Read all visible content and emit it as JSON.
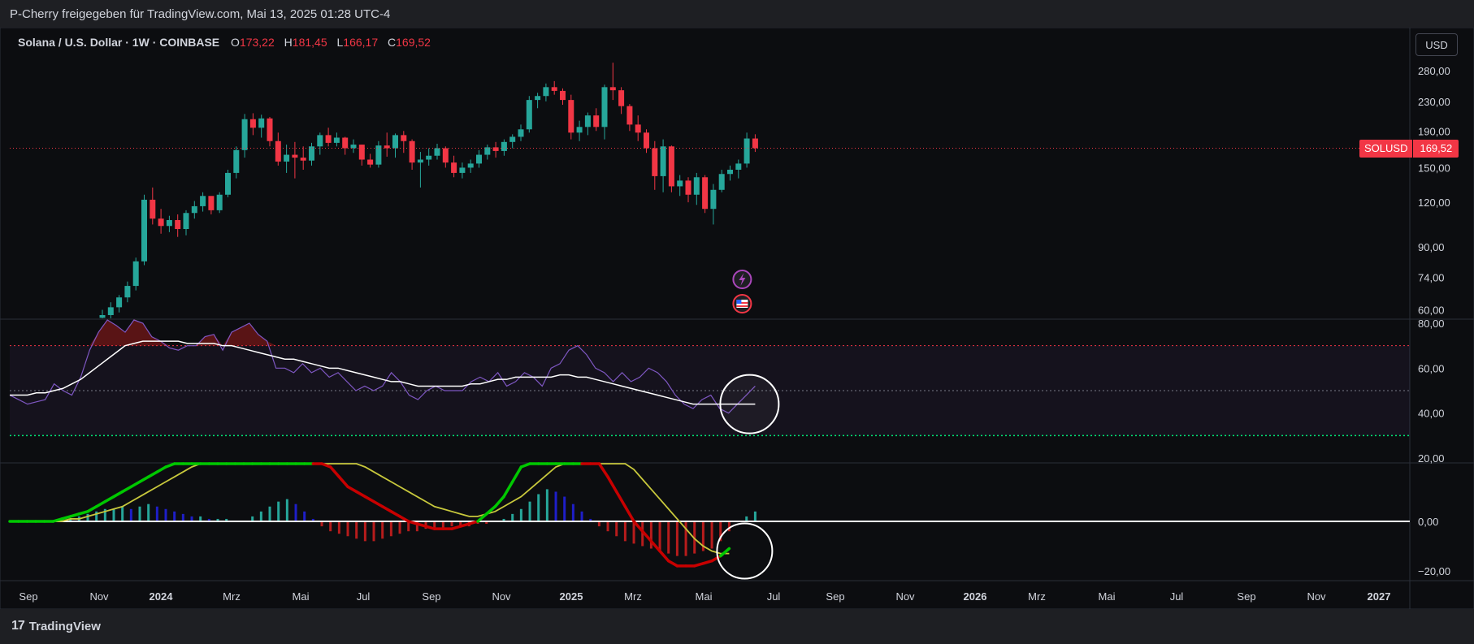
{
  "header": {
    "text": "P-Cherry freigegeben für TradingView.com, Mai 13, 2025 01:28 UTC-4"
  },
  "footer": {
    "brand": "TradingView",
    "logo_icon": "tradingview-logo-icon"
  },
  "legend": {
    "symbol": "Solana / U.S. Dollar · 1W · COINBASE",
    "open_label": "O",
    "open": "173,22",
    "high_label": "H",
    "high": "181,45",
    "low_label": "L",
    "low": "166,17",
    "close_label": "C",
    "close": "169,52"
  },
  "currency": "USD",
  "price_tag": {
    "symbol": "SOLUSD",
    "price": "169,52"
  },
  "colors": {
    "up": "#26a69a",
    "down": "#f23645",
    "rsi": "#7e57c2",
    "rsi_ma": "#ffffff",
    "macd_up": "#00c800",
    "macd_down": "#c80000",
    "signal": "#c8c83c",
    "hist_pos_strong": "#26a69a",
    "hist_pos_weak": "#1e1ec8",
    "hist_neg": "#b71c1c"
  },
  "chart_data": [
    {
      "type": "candlestick",
      "panel": "price",
      "title": "Solana / U.S. Dollar · 1W · COINBASE",
      "y_scale": "log",
      "ylim": [
        58,
        300
      ],
      "y_ticks": [
        "280,00",
        "230,00",
        "190,00",
        "150,00",
        "120,00",
        "90,00",
        "74,00",
        "60,00"
      ],
      "y_tick_values": [
        280,
        230,
        190,
        150,
        120,
        90,
        74,
        60
      ],
      "candles": [
        [
          57,
          60,
          55,
          58
        ],
        [
          58,
          63,
          56,
          61
        ],
        [
          61,
          66,
          59,
          65
        ],
        [
          65,
          72,
          63,
          70
        ],
        [
          70,
          84,
          68,
          82
        ],
        [
          82,
          126,
          80,
          122
        ],
        [
          122,
          132,
          104,
          108
        ],
        [
          108,
          115,
          98,
          103
        ],
        [
          103,
          110,
          99,
          107
        ],
        [
          107,
          111,
          96,
          101
        ],
        [
          101,
          114,
          97,
          112
        ],
        [
          112,
          121,
          108,
          117
        ],
        [
          117,
          128,
          113,
          125
        ],
        [
          125,
          122,
          111,
          114
        ],
        [
          114,
          128,
          112,
          126
        ],
        [
          126,
          148,
          124,
          145
        ],
        [
          145,
          172,
          140,
          168
        ],
        [
          168,
          212,
          160,
          205
        ],
        [
          205,
          213,
          185,
          194
        ],
        [
          194,
          211,
          182,
          206
        ],
        [
          206,
          208,
          172,
          178
        ],
        [
          178,
          188,
          152,
          156
        ],
        [
          156,
          174,
          145,
          163
        ],
        [
          163,
          177,
          140,
          160
        ],
        [
          160,
          172,
          148,
          157
        ],
        [
          157,
          176,
          152,
          172
        ],
        [
          172,
          188,
          163,
          185
        ],
        [
          185,
          194,
          172,
          176
        ],
        [
          176,
          188,
          172,
          182
        ],
        [
          182,
          183,
          163,
          170
        ],
        [
          170,
          180,
          165,
          174
        ],
        [
          174,
          174,
          152,
          158
        ],
        [
          158,
          164,
          150,
          153
        ],
        [
          153,
          178,
          150,
          173
        ],
        [
          173,
          188,
          161,
          170
        ],
        [
          170,
          187,
          160,
          185
        ],
        [
          185,
          190,
          165,
          178
        ],
        [
          178,
          180,
          148,
          155
        ],
        [
          155,
          166,
          132,
          158
        ],
        [
          158,
          170,
          152,
          162
        ],
        [
          162,
          175,
          158,
          170
        ],
        [
          170,
          172,
          150,
          155
        ],
        [
          155,
          162,
          141,
          145
        ],
        [
          145,
          155,
          140,
          150
        ],
        [
          150,
          158,
          145,
          154
        ],
        [
          154,
          168,
          150,
          163
        ],
        [
          163,
          174,
          158,
          171
        ],
        [
          171,
          177,
          160,
          167
        ],
        [
          167,
          180,
          162,
          177
        ],
        [
          177,
          186,
          170,
          183
        ],
        [
          183,
          198,
          178,
          192
        ],
        [
          192,
          238,
          188,
          232
        ],
        [
          232,
          243,
          220,
          238
        ],
        [
          238,
          258,
          230,
          252
        ],
        [
          252,
          262,
          240,
          246
        ],
        [
          246,
          250,
          225,
          232
        ],
        [
          232,
          240,
          180,
          188
        ],
        [
          188,
          203,
          178,
          195
        ],
        [
          195,
          214,
          185,
          210
        ],
        [
          210,
          220,
          190,
          195
        ],
        [
          195,
          256,
          180,
          252
        ],
        [
          252,
          295,
          232,
          247
        ],
        [
          247,
          252,
          212,
          223
        ],
        [
          223,
          226,
          190,
          198
        ],
        [
          198,
          210,
          178,
          188
        ],
        [
          188,
          192,
          165,
          170
        ],
        [
          170,
          178,
          130,
          142
        ],
        [
          142,
          180,
          128,
          172
        ],
        [
          172,
          173,
          128,
          133
        ],
        [
          133,
          143,
          125,
          138
        ],
        [
          138,
          141,
          120,
          126
        ],
        [
          126,
          145,
          118,
          141
        ],
        [
          141,
          143,
          112,
          115
        ],
        [
          115,
          135,
          104,
          130
        ],
        [
          130,
          148,
          128,
          144
        ],
        [
          144,
          152,
          138,
          148
        ],
        [
          148,
          158,
          140,
          154
        ],
        [
          154,
          188,
          150,
          181
        ],
        [
          181,
          186,
          166,
          170
        ]
      ]
    },
    {
      "type": "line",
      "panel": "rsi",
      "ylim": [
        20,
        80
      ],
      "y_ticks": [
        "80,00",
        "60,00",
        "40,00",
        "20,00"
      ],
      "y_tick_values": [
        80,
        60,
        40,
        20
      ],
      "levels": [
        70,
        50,
        30
      ],
      "series": [
        {
          "values": [
            48,
            46,
            44,
            45,
            46,
            53,
            50,
            48,
            56,
            68,
            76,
            82,
            79,
            76,
            83,
            80,
            74,
            72,
            69,
            68,
            70,
            70,
            74,
            75,
            68,
            76,
            78,
            80,
            75,
            72,
            60,
            60,
            58,
            62,
            58,
            60,
            56,
            58,
            54,
            50,
            52,
            50,
            52,
            58,
            54,
            48,
            46,
            50,
            52,
            50,
            50,
            50,
            54,
            56,
            54,
            58,
            52,
            54,
            58,
            56,
            52,
            60,
            62,
            68,
            70,
            66,
            60,
            58,
            54,
            58,
            54,
            56,
            60,
            58,
            54,
            48,
            44,
            42,
            46,
            48,
            42,
            40,
            44,
            48,
            52
          ]
        },
        {
          "values": [
            48,
            48,
            48,
            49,
            49,
            50,
            51,
            53,
            55,
            58,
            61,
            64,
            67,
            70,
            71,
            72,
            72,
            72,
            72,
            72,
            71,
            71,
            71,
            71,
            70,
            70,
            69,
            68,
            67,
            66,
            65,
            64,
            64,
            63,
            62,
            61,
            60,
            60,
            59,
            58,
            57,
            56,
            55,
            54,
            54,
            53,
            52,
            52,
            52,
            52,
            52,
            52,
            53,
            53,
            54,
            55,
            55,
            56,
            56,
            56,
            56,
            56,
            57,
            57,
            56,
            56,
            55,
            54,
            53,
            52,
            51,
            50,
            49,
            48,
            47,
            46,
            45,
            44,
            44,
            44,
            44,
            44,
            44,
            44,
            44
          ]
        }
      ]
    },
    {
      "type": "bar_line",
      "panel": "macd",
      "ylim": [
        -22,
        22
      ],
      "y_ticks": [
        "0,00",
        "−20,00"
      ],
      "y_tick_values": [
        0,
        -20
      ],
      "histogram": [
        0,
        0,
        0,
        0,
        0,
        0,
        1,
        1,
        2,
        3,
        4,
        5,
        5,
        6,
        5,
        6,
        7,
        6,
        5,
        4,
        3,
        2,
        2,
        1,
        1,
        1,
        0,
        0,
        2,
        4,
        6,
        8,
        9,
        7,
        4,
        1,
        -2,
        -4,
        -5,
        -6,
        -7,
        -8,
        -8,
        -7,
        -6,
        -5,
        -4,
        -4,
        -3,
        -3,
        -3,
        -2,
        -2,
        -2,
        -1,
        -1,
        0,
        1,
        3,
        5,
        8,
        11,
        13,
        12,
        10,
        7,
        4,
        1,
        -2,
        -4,
        -6,
        -8,
        -9,
        -10,
        -11,
        -12,
        -13,
        -14,
        -14,
        -13,
        -12,
        -11,
        -8,
        -4,
        0,
        2,
        4
      ],
      "series": [
        {
          "values": [
            0,
            0,
            0,
            0,
            0,
            0,
            1,
            2,
            3,
            4,
            6,
            8,
            10,
            12,
            14,
            16,
            18,
            20,
            22,
            24,
            26,
            28,
            30,
            30,
            30,
            30,
            30,
            30,
            30,
            30,
            30,
            30,
            30,
            30,
            30,
            30,
            26,
            22,
            18,
            14,
            12,
            10,
            8,
            6,
            4,
            2,
            0,
            -1,
            -2,
            -3,
            -3,
            -3,
            -2,
            -1,
            0,
            3,
            6,
            10,
            16,
            22,
            28,
            30,
            30,
            30,
            30,
            30,
            30,
            28,
            24,
            18,
            12,
            6,
            0,
            -4,
            -8,
            -12,
            -16,
            -18,
            -18,
            -18,
            -17,
            -16,
            -14,
            -11
          ]
        },
        {
          "values": [
            0,
            0,
            0,
            0,
            0,
            0,
            0,
            1,
            1,
            2,
            3,
            4,
            5,
            6,
            8,
            10,
            12,
            14,
            16,
            18,
            20,
            22,
            24,
            26,
            28,
            30,
            30,
            30,
            30,
            30,
            30,
            30,
            30,
            30,
            30,
            30,
            30,
            29,
            28,
            26,
            24,
            22,
            20,
            18,
            16,
            14,
            12,
            10,
            8,
            6,
            5,
            4,
            3,
            2,
            2,
            3,
            4,
            6,
            8,
            10,
            13,
            16,
            19,
            22,
            25,
            28,
            30,
            30,
            30,
            29,
            27,
            24,
            21,
            17,
            13,
            9,
            5,
            1,
            -3,
            -7,
            -10,
            -12,
            -13,
            -13
          ]
        }
      ]
    }
  ],
  "time_axis": [
    "Sep",
    "Nov",
    "2024",
    "Mrz",
    "Mai",
    "Jul",
    "Sep",
    "Nov",
    "2025",
    "Mrz",
    "Mai",
    "Jul",
    "Sep",
    "Nov",
    "2026",
    "Mrz",
    "Mai",
    "Jul",
    "Sep",
    "Nov",
    "2027"
  ]
}
